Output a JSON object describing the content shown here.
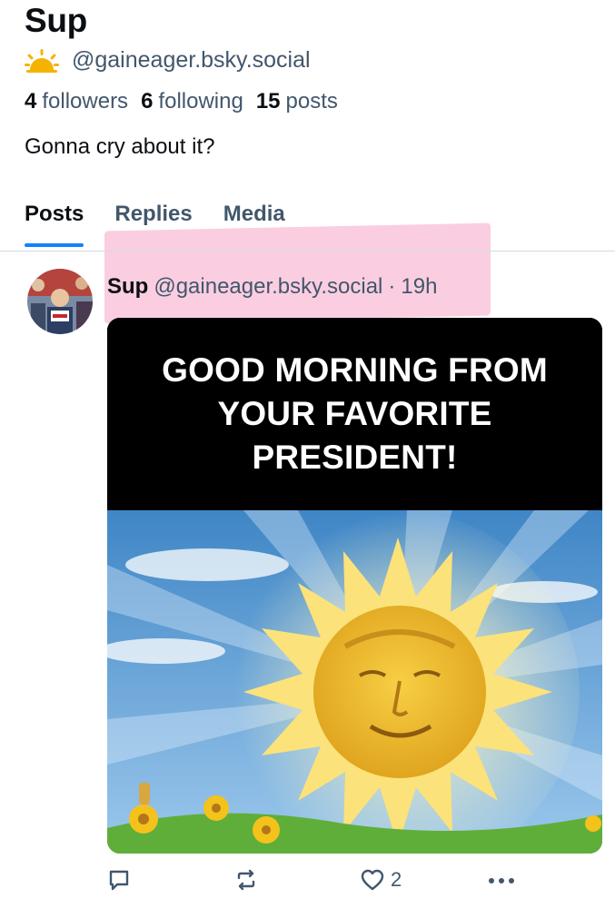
{
  "profile": {
    "display_name": "Sup",
    "handle": "@gaineager.bsky.social",
    "handle_icon": "sun-emoji-icon",
    "stats": {
      "followers_count": "4",
      "followers_label": "followers",
      "following_count": "6",
      "following_label": "following",
      "posts_count": "15",
      "posts_label": "posts"
    },
    "bio": "Gonna cry about it?"
  },
  "tabs": [
    {
      "label": "Posts",
      "active": true
    },
    {
      "label": "Replies",
      "active": false
    },
    {
      "label": "Media",
      "active": false
    }
  ],
  "post": {
    "author": "Sup",
    "handle": "@gaineager.bsky.social",
    "separator": "·",
    "time": "19h",
    "image_caption": "GOOD MORNING FROM\nYOUR FAVORITE\nPRESIDENT!",
    "actions": {
      "reply_icon": "comment-icon",
      "repost_icon": "repost-icon",
      "like_icon": "heart-icon",
      "like_count": "2",
      "more_icon": "more-dots-icon"
    }
  },
  "colors": {
    "accent": "#1083fe",
    "muted_text": "#42576c",
    "highlight": "#f6a6c6"
  }
}
